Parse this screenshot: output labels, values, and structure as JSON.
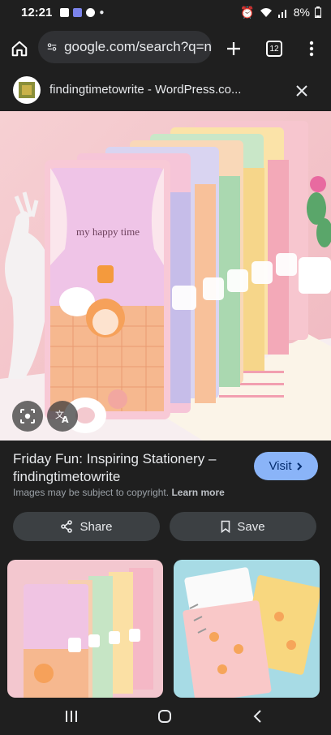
{
  "status_bar": {
    "time": "12:21",
    "battery": "8%"
  },
  "browser": {
    "url_text": "google.com/search?q=n",
    "tab_count": "12"
  },
  "result_header": {
    "site_title": "findingtimetowrite - WordPress.co..."
  },
  "hero_image": {
    "overlay_text": "my happy time"
  },
  "result": {
    "title": "Friday Fun: Inspiring Stationery – findingtimetowrite",
    "visit_label": "Visit",
    "copyright_note": "Images may be subject to copyright.",
    "learn_more": "Learn more"
  },
  "actions": {
    "share_label": "Share",
    "save_label": "Save"
  },
  "colors": {
    "background": "#1f1f1f",
    "accent": "#8ab4f8",
    "button": "#3c4043"
  }
}
